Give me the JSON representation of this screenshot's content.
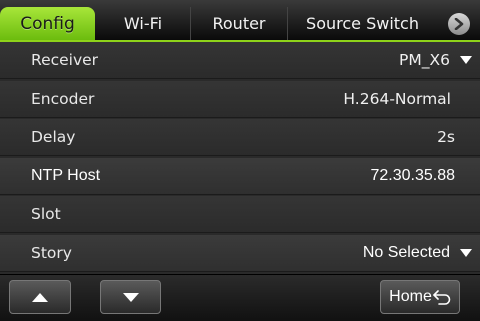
{
  "tabs": [
    {
      "label": "Config",
      "active": true
    },
    {
      "label": "Wi-Fi",
      "active": false
    },
    {
      "label": "Router",
      "active": false
    },
    {
      "label": "Source Switch",
      "active": false
    }
  ],
  "tab_more_icon": "chevron-right-circle-icon",
  "settings": {
    "receiver": {
      "label": "Receiver",
      "value": "PM_X6"
    },
    "encoder": {
      "label": "Encoder",
      "value": "H.264-Normal"
    },
    "delay": {
      "label": "Delay",
      "value": "2s"
    },
    "ntp_host": {
      "label": "NTP Host",
      "value": "72.30.35.88"
    },
    "slot": {
      "label": "Slot",
      "value": ""
    },
    "story": {
      "label": "Story",
      "value": "No Selected"
    }
  },
  "bottom": {
    "up_icon": "arrow-up-icon",
    "down_icon": "arrow-down-icon",
    "home_label": "Home",
    "home_icon": "return-arrow-icon"
  },
  "colors": {
    "accent": "#8ed31a",
    "background": "#2a2a2a",
    "text": "#ffffff"
  }
}
